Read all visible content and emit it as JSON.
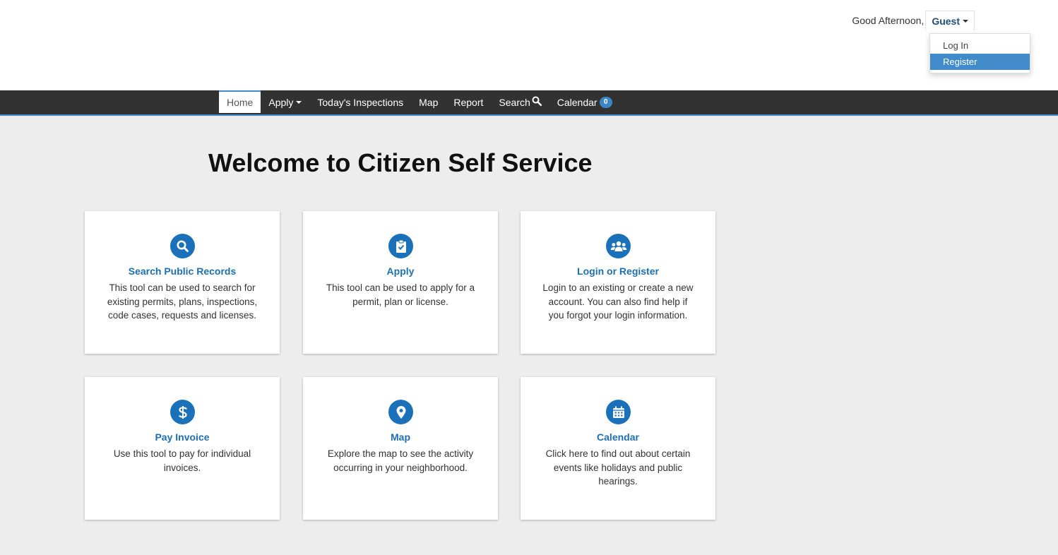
{
  "header": {
    "greeting": "Good Afternoon,",
    "user": "Guest",
    "menu": [
      {
        "label": "Log In"
      },
      {
        "label": "Register"
      }
    ]
  },
  "nav": {
    "items": [
      {
        "label": "Home"
      },
      {
        "label": "Apply"
      },
      {
        "label": "Today's Inspections"
      },
      {
        "label": "Map"
      },
      {
        "label": "Report"
      },
      {
        "label": "Search"
      },
      {
        "label": "Calendar"
      }
    ],
    "calendar_count": "0",
    "active": "Home"
  },
  "page": {
    "title": "Welcome to Citizen Self Service"
  },
  "cards": [
    {
      "title": "Search Public Records",
      "desc": "This tool can be used to search for existing permits, plans, inspections, code cases, requests and licenses.",
      "icon": "search-icon"
    },
    {
      "title": "Apply",
      "desc": "This tool can be used to apply for a permit, plan or license.",
      "icon": "clipboard-check-icon"
    },
    {
      "title": "Login or Register",
      "desc": "Login to an existing or create a new account. You can also find help if you forgot your login information.",
      "icon": "users-icon"
    },
    {
      "title": "Pay Invoice",
      "desc": "Use this tool to pay for individual invoices.",
      "icon": "dollar-icon"
    },
    {
      "title": "Map",
      "desc": "Explore the map to see the activity occurring in your neighborhood.",
      "icon": "map-pin-icon"
    },
    {
      "title": "Calendar",
      "desc": "Click here to find out about certain events like holidays and public hearings.",
      "icon": "calendar-icon"
    }
  ],
  "colors": {
    "navbar": "#323232",
    "accent": "#428bca",
    "icon_bg": "#1a70b9",
    "card_title": "#1f6fb0",
    "page_bg": "#ededed"
  }
}
